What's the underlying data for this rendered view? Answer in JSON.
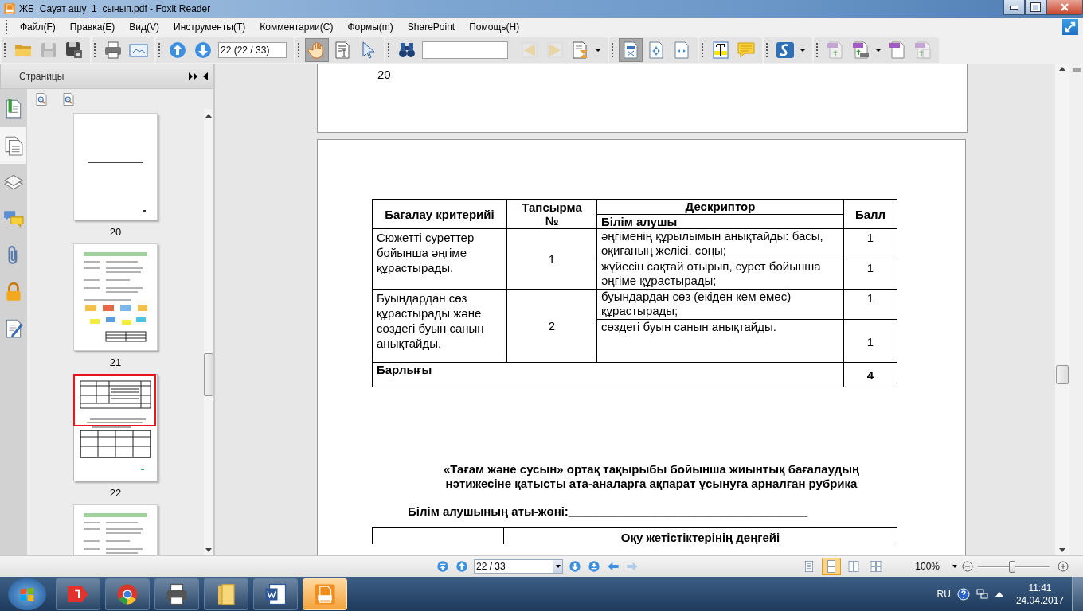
{
  "window": {
    "title": "ЖБ_Сауат ашу_1_сынып.pdf - Foxit Reader"
  },
  "menu": [
    "Файл(F)",
    "Правка(E)",
    "Вид(V)",
    "Инструменты(T)",
    "Комментарии(C)",
    "Формы(m)",
    "SharePoint",
    "Помощь(H)"
  ],
  "toolbar": {
    "groups": [
      [
        {
          "kind": "open",
          "selected": false,
          "disabled": false
        },
        {
          "kind": "save",
          "selected": false,
          "disabled": true
        },
        {
          "kind": "save_as",
          "selected": false,
          "disabled": false
        }
      ],
      [
        {
          "kind": "print",
          "selected": false,
          "disabled": false
        },
        {
          "kind": "scan",
          "selected": false,
          "disabled": false
        }
      ],
      [
        {
          "kind": "page_up",
          "selected": false,
          "disabled": false
        },
        {
          "kind": "page_down",
          "selected": false,
          "disabled": false
        },
        {
          "kind": "page_field",
          "value": "22 (22 / 33)"
        }
      ],
      [
        {
          "kind": "hand",
          "selected": true,
          "disabled": false
        },
        {
          "kind": "select_text",
          "selected": false,
          "disabled": false
        },
        {
          "kind": "pointer",
          "selected": false,
          "disabled": false
        }
      ],
      [
        {
          "kind": "find",
          "selected": false,
          "disabled": false
        },
        {
          "kind": "search_field"
        },
        {
          "kind": "find_prev",
          "selected": false,
          "disabled": true
        },
        {
          "kind": "find_next",
          "selected": false,
          "disabled": true
        },
        {
          "kind": "search_doc",
          "selected": false,
          "disabled": false,
          "dropdown": true
        }
      ],
      [
        {
          "kind": "actual_size",
          "selected": true,
          "disabled": false
        },
        {
          "kind": "fit_page",
          "selected": false,
          "disabled": false
        },
        {
          "kind": "fit_width",
          "selected": false,
          "disabled": false
        }
      ],
      [
        {
          "kind": "typewriter",
          "selected": false,
          "disabled": false
        },
        {
          "kind": "note",
          "selected": false,
          "disabled": false
        }
      ],
      [
        {
          "kind": "sign",
          "selected": false,
          "disabled": false,
          "dropdown": true
        }
      ],
      [
        {
          "kind": "pdf_create",
          "selected": false,
          "disabled": true
        },
        {
          "kind": "pdf_print",
          "selected": false,
          "disabled": false,
          "dropdown": true
        },
        {
          "kind": "pdf_blank",
          "selected": false,
          "disabled": false
        },
        {
          "kind": "pdf_combine",
          "selected": false,
          "disabled": true
        }
      ]
    ]
  },
  "sidebar": {
    "title": "Страницы",
    "tabs": [
      {
        "kind": "bookmarks",
        "selected": false
      },
      {
        "kind": "pages",
        "selected": true
      },
      {
        "kind": "layers",
        "selected": false
      },
      {
        "kind": "comments",
        "selected": false
      },
      {
        "kind": "attachments",
        "selected": false
      },
      {
        "kind": "security",
        "selected": false
      },
      {
        "kind": "signatures",
        "selected": false
      }
    ],
    "thumbnails": [
      {
        "kind": "title_page",
        "label": "20",
        "selected": false
      },
      {
        "kind": "worksheet",
        "label": "21",
        "selected": false
      },
      {
        "kind": "table_page",
        "label": "22",
        "selected": true
      },
      {
        "kind": "worksheet",
        "selected": false
      }
    ]
  },
  "document": {
    "previous_page": {
      "page_number": "20"
    },
    "table": {
      "columns": [
        "Бағалау критерийі",
        "Тапсырма №",
        "Дескриптор",
        "Балл"
      ],
      "subheader": "Білім алушы",
      "groups": [
        {
          "criterion": "Сюжетті суреттер бойынша  әңгіме құрастырады.",
          "task": "1",
          "descriptors": [
            {
              "text": "әңгіменің құрылымын анықтайды: басы, оқиғаның желісі, соңы;",
              "score": "1"
            },
            {
              "text": "жүйесін сақтай отырып, сурет бойынша әңгіме құрастырады;",
              "score": "1"
            }
          ]
        },
        {
          "criterion": "Буындардан сөз құрастырады және сөздегі буын санын анықтайды.",
          "task": "2",
          "descriptors": [
            {
              "text": "буындардан сөз (екіден кем емес) құрастырады;",
              "score": "1"
            },
            {
              "text": "сөздегі буын санын анықтайды.",
              "score": "1"
            }
          ]
        }
      ],
      "total": {
        "label": "Барлығы",
        "score": "4"
      }
    },
    "heading": "«Тағам және сусын» ортақ тақырыбы бойынша жиынтық бағалаудың нәтижесіне қатысты ата-аналарға ақпарат ұсынуға арналған рубрика",
    "name_line": "Білім алушының аты-жөні:____________________________________",
    "table_2": {
      "column_2_header": "Оқу жетістіктерінің деңгейі"
    }
  },
  "navbar": {
    "before": [
      {
        "kind": "first",
        "disabled": false
      },
      {
        "kind": "previous",
        "disabled": false
      }
    ],
    "page_field": "22 / 33",
    "after": [
      {
        "kind": "next",
        "disabled": false
      },
      {
        "kind": "last",
        "disabled": false
      },
      {
        "kind": "back",
        "disabled": false
      },
      {
        "kind": "forward",
        "disabled": true
      }
    ],
    "view_modes": [
      {
        "kind": "single",
        "selected": false
      },
      {
        "kind": "continuous",
        "selected": true
      },
      {
        "kind": "facing",
        "selected": false
      },
      {
        "kind": "continuous_facing",
        "selected": false
      }
    ],
    "zoom": {
      "value": "100%",
      "level": 0.48
    }
  },
  "taskbar": {
    "apps": [
      {
        "kind": "yandex",
        "selected": false
      },
      {
        "kind": "chrome",
        "selected": false
      },
      {
        "kind": "printer",
        "selected": false
      },
      {
        "kind": "explorer",
        "selected": false
      },
      {
        "kind": "word",
        "selected": false
      },
      {
        "kind": "foxit",
        "selected": true
      }
    ],
    "language": "RU",
    "time": "11:41",
    "date": "24.04.2017"
  }
}
